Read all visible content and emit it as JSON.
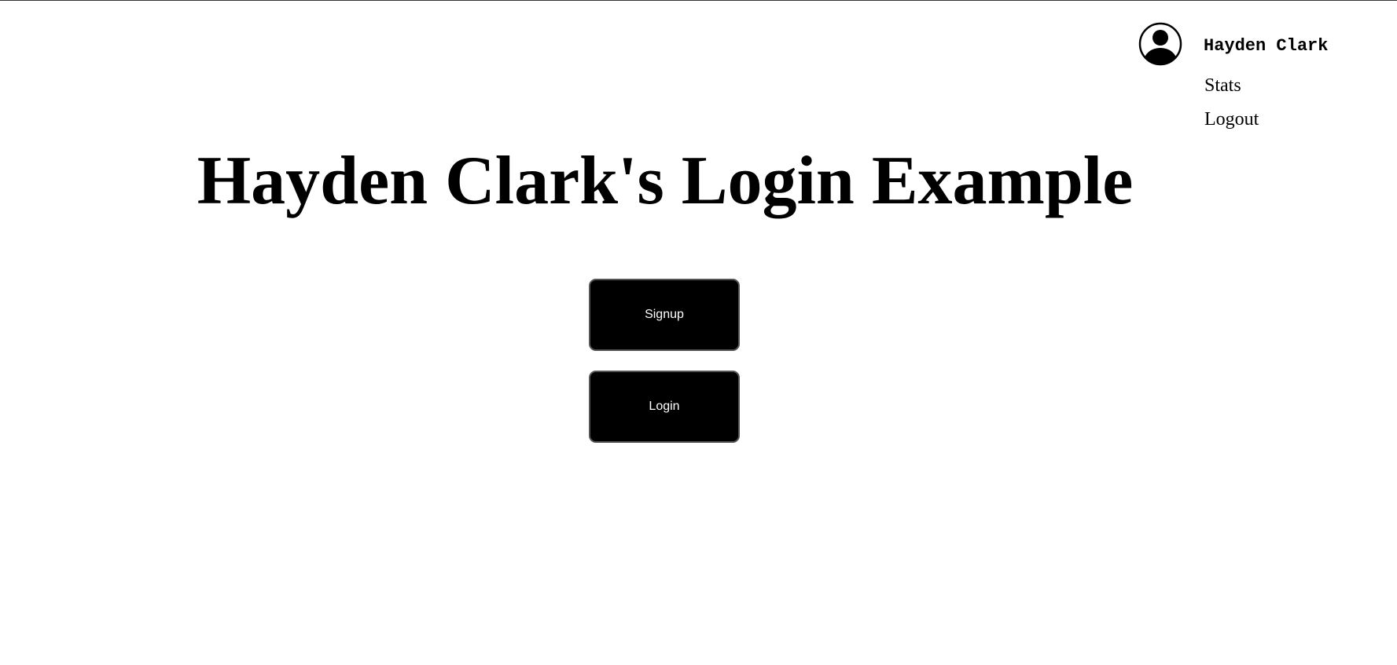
{
  "header": {
    "user": {
      "avatar_icon": "user-circle-icon",
      "name": "Hayden Clark"
    },
    "menu": [
      {
        "label": "Stats"
      },
      {
        "label": "Logout"
      }
    ]
  },
  "main": {
    "title": "Hayden Clark's Login Example",
    "buttons": {
      "signup_label": "Signup",
      "login_label": "Login"
    }
  },
  "colors": {
    "background": "#ffffff",
    "text": "#000000",
    "button_background": "#000000",
    "button_text": "#ffffff"
  }
}
